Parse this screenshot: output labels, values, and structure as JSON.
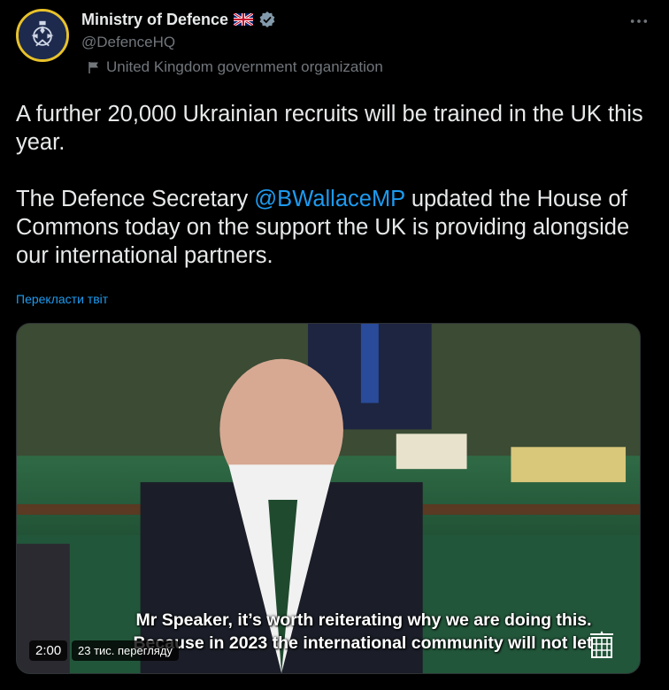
{
  "author": {
    "display_name": "Ministry of Defence",
    "handle": "@DefenceHQ",
    "affiliation": "United Kingdom government organization"
  },
  "tweet": {
    "line1": "A further 20,000 Ukrainian recruits will be trained in the UK this year.",
    "line2_before": "The Defence Secretary ",
    "mention": "@BWallaceMP",
    "line2_after": " updated the House of Commons today on the support the UK is providing alongside our international partners.",
    "translate_label": "Перекласти твіт"
  },
  "media": {
    "subtitle_1": "Mr Speaker, it’s worth reiterating why we are doing this.",
    "subtitle_2": "Because in 2023 the international community will not let",
    "duration": "2:00",
    "views": "23 тис. перегляду"
  },
  "icons": {
    "verified": "verified-badge-icon",
    "flag": "uk-flag-icon",
    "more": "more-icon",
    "parliament": "portcullis-icon"
  },
  "colors": {
    "background": "#000000",
    "text": "#e7e9ea",
    "secondary": "#71767b",
    "accent": "#1d9bf0"
  }
}
